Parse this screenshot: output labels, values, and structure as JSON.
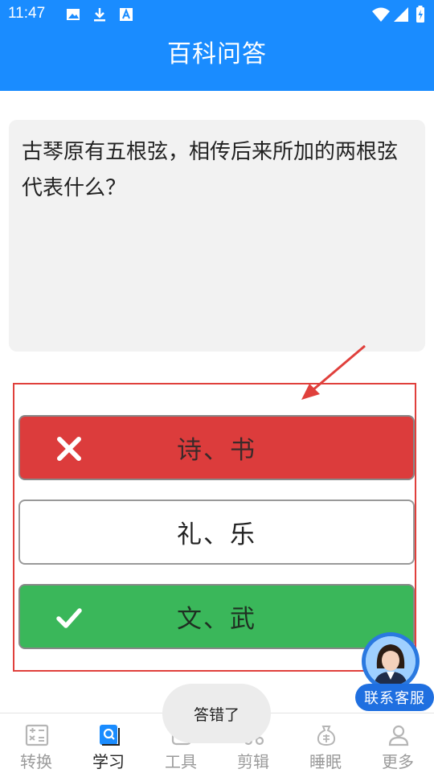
{
  "status_bar": {
    "time": "11:47"
  },
  "app_bar": {
    "title": "百科问答"
  },
  "question": {
    "text": "古琴原有五根弦，相传后来所加的两根弦代表什么？"
  },
  "options": [
    {
      "label": "诗、书",
      "state": "wrong",
      "mark": "close-icon"
    },
    {
      "label": "礼、乐",
      "state": "neutral"
    },
    {
      "label": "文、武",
      "state": "correct",
      "mark": "check-icon"
    }
  ],
  "toast": {
    "text": "答错了"
  },
  "customer_service": {
    "label": "联系客服"
  },
  "bottom_nav": [
    {
      "label": "转换",
      "icon": "convert-icon",
      "active": false
    },
    {
      "label": "学习",
      "icon": "book-icon",
      "active": true
    },
    {
      "label": "工具",
      "icon": "tools-icon",
      "active": false
    },
    {
      "label": "剪辑",
      "icon": "scissors-icon",
      "active": false
    },
    {
      "label": "睡眠",
      "icon": "money-bag-icon",
      "active": false
    },
    {
      "label": "更多",
      "icon": "user-icon",
      "active": false
    }
  ],
  "colors": {
    "primary": "#1a8cff",
    "wrong": "#dc3c3c",
    "correct": "#3ab75a",
    "annotation": "#e0403c"
  }
}
